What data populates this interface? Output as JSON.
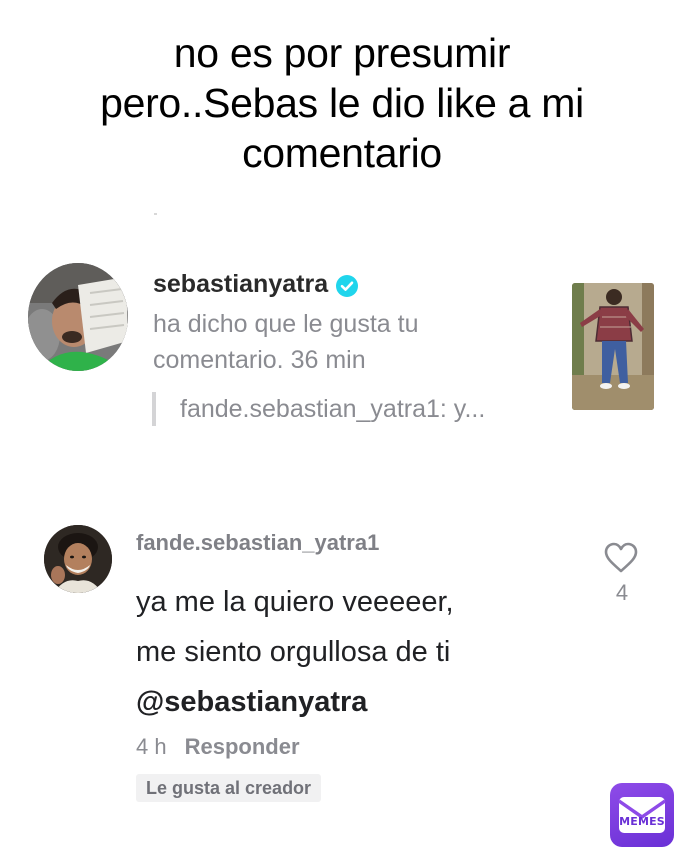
{
  "caption": {
    "line1": "no es por presumir",
    "line2": "pero..Sebas le dio like a mi",
    "line3": "comentario"
  },
  "notification": {
    "username": "sebastianyatra",
    "text_line1": "ha dicho que le gusta tu",
    "text_line2": "comentario.",
    "time": "36 min",
    "quote": "fande.sebastian_yatra1: y..."
  },
  "comment": {
    "username": "fande.sebastian_yatra1",
    "line1": "ya me la quiero veeeeer,",
    "line2": "me siento orgullosa de ti",
    "mention": "@sebastianyatra",
    "time": "4 h",
    "reply_label": "Responder",
    "like_count": "4",
    "creator_badge": "Le gusta al creador"
  },
  "watermark": {
    "label": "MEMES"
  },
  "colors": {
    "verified": "#20d5ec",
    "logo": "#7b3fe4"
  }
}
